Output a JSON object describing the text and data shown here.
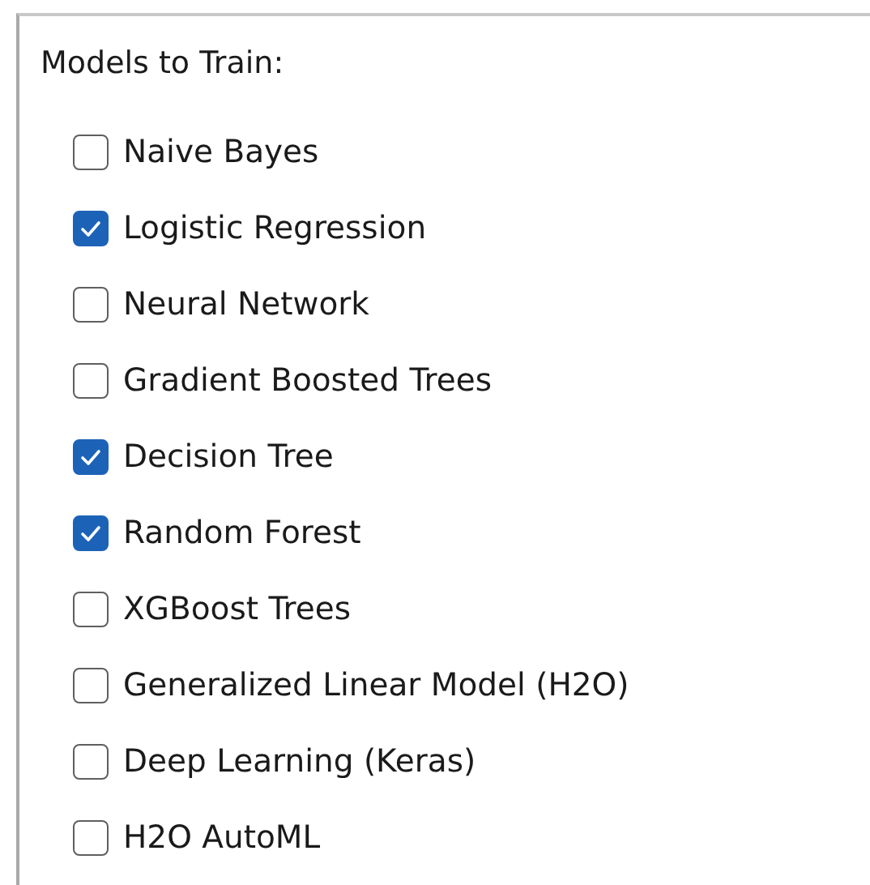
{
  "group": {
    "title": "Models to Train:"
  },
  "models": [
    {
      "label": "Naive Bayes",
      "checked": false
    },
    {
      "label": "Logistic Regression",
      "checked": true
    },
    {
      "label": "Neural Network",
      "checked": false
    },
    {
      "label": "Gradient Boosted Trees",
      "checked": false
    },
    {
      "label": "Decision Tree",
      "checked": true
    },
    {
      "label": "Random Forest",
      "checked": true
    },
    {
      "label": "XGBoost Trees",
      "checked": false
    },
    {
      "label": "Generalized Linear Model (H2O)",
      "checked": false
    },
    {
      "label": "Deep Learning (Keras)",
      "checked": false
    },
    {
      "label": "H2O AutoML",
      "checked": false
    }
  ]
}
